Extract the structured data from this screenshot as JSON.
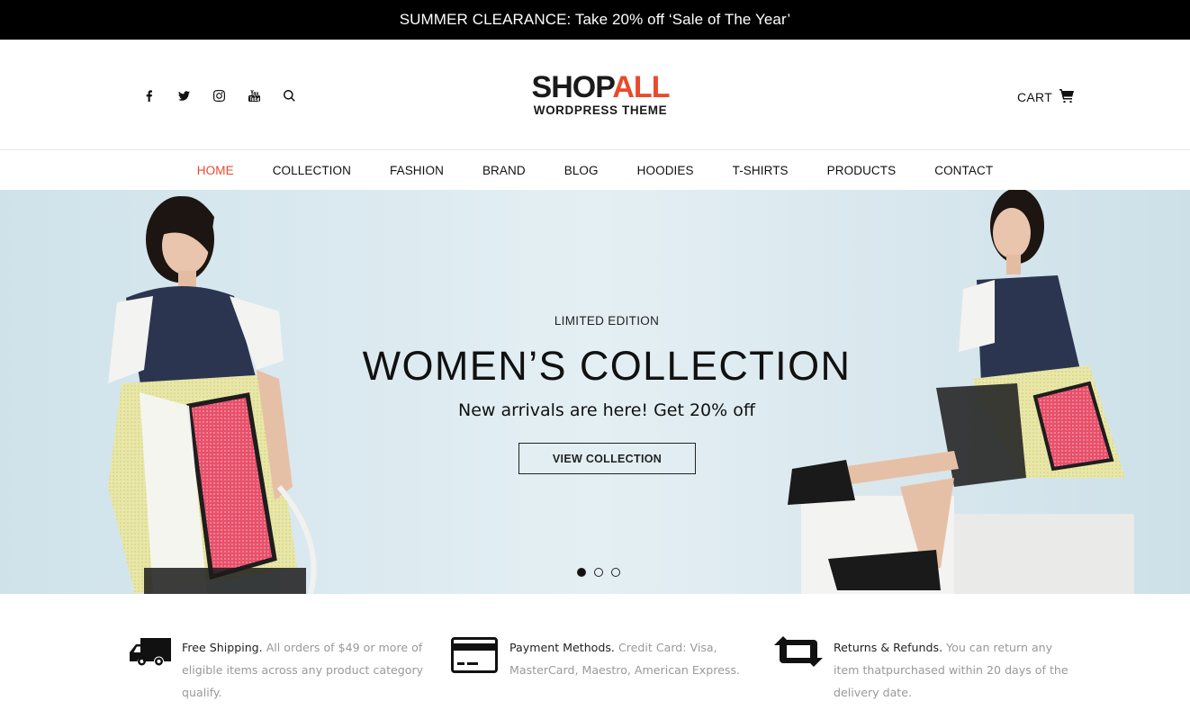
{
  "announcement": "SUMMER CLEARANCE: Take 20% off ‘Sale of The Year’",
  "header": {
    "social": [
      "facebook-icon",
      "twitter-icon",
      "instagram-icon",
      "youtube-icon",
      "search-icon"
    ],
    "logo": {
      "word1": "SHOP",
      "word2": "ALL",
      "tagline": "WORDPRESS THEME"
    },
    "cart_label": "CART"
  },
  "nav": {
    "items": [
      "HOME",
      "COLLECTION",
      "FASHION",
      "BRAND",
      "BLOG",
      "HOODIES",
      "T-SHIRTS",
      "PRODUCTS",
      "CONTACT"
    ],
    "active": "HOME"
  },
  "hero": {
    "eyebrow": "LIMITED EDITION",
    "headline": "WOMEN’S COLLECTION",
    "subtitle": "New arrivals are here! Get 20% off",
    "cta": "VIEW COLLECTION",
    "slides": 3,
    "active_slide": 1
  },
  "features": [
    {
      "icon": "truck-icon",
      "title": "Free Shipping.",
      "text": "All orders of $49 or more of eligible items across any product category qualify."
    },
    {
      "icon": "credit-card-icon",
      "title": "Payment Methods.",
      "text": "Credit Card: Visa, MasterCard, Maestro, American Express."
    },
    {
      "icon": "retweet-icon",
      "title": "Returns & Refunds.",
      "text": "You can return any item thatpurchased within 20 days of the delivery date."
    }
  ],
  "colors": {
    "accent": "#e94a2d",
    "topbar": "#000000",
    "hero_bg": "#dbeaf0"
  }
}
